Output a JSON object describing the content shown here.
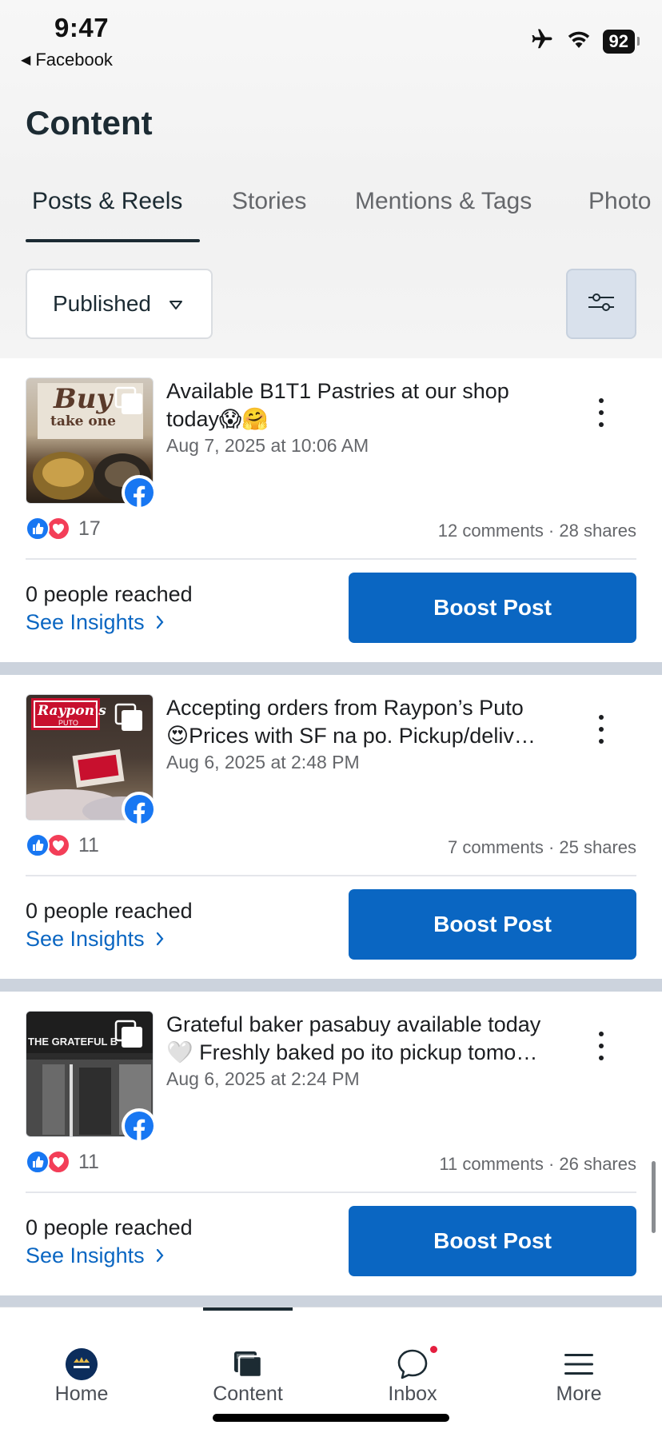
{
  "status_bar": {
    "time": "9:47",
    "back_app": "Facebook",
    "battery": "92"
  },
  "page": {
    "title": "Content"
  },
  "tabs": [
    {
      "label": "Posts & Reels",
      "active": true
    },
    {
      "label": "Stories",
      "active": false
    },
    {
      "label": "Mentions & Tags",
      "active": false
    },
    {
      "label": "Photo",
      "active": false
    }
  ],
  "filter": {
    "selected": "Published"
  },
  "posts": [
    {
      "text_line1": "Available B1T1 Pastries at our shop",
      "text_line2": "today😱🤗",
      "date": "Aug 7, 2025 at 10:06 AM",
      "reactions": "17",
      "engagement": "12 comments · 28 shares",
      "reach": "0 people reached",
      "insights_label": "See Insights",
      "boost_label": "Boost Post",
      "thumb_text_1": "Buy",
      "thumb_text_2": "take one"
    },
    {
      "text_line1": "Accepting orders from Raypon’s Puto",
      "text_line2": "😍Prices with SF na po. Pickup/deliv…",
      "date": "Aug 6, 2025 at 2:48 PM",
      "reactions": "11",
      "engagement": "7 comments · 25 shares",
      "reach": "0 people reached",
      "insights_label": "See Insights",
      "boost_label": "Boost Post",
      "thumb_text_1": "Raypon's",
      "thumb_text_2": "PUTO"
    },
    {
      "text_line1": "Grateful baker pasabuy available today",
      "text_line2": "🤍 Freshly baked po ito pickup tomo…",
      "date": "Aug 6, 2025 at 2:24 PM",
      "reactions": "11",
      "engagement": "11 comments · 26 shares",
      "reach": "0 people reached",
      "insights_label": "See Insights",
      "boost_label": "Boost Post",
      "thumb_text_1": "THE GRATEFUL B"
    }
  ],
  "bottom_nav": [
    {
      "label": "Home",
      "icon": "page-avatar-icon"
    },
    {
      "label": "Content",
      "icon": "content-icon",
      "active": true
    },
    {
      "label": "Inbox",
      "icon": "inbox-chat-icon",
      "has_notification": true
    },
    {
      "label": "More",
      "icon": "menu-icon"
    }
  ],
  "colors": {
    "accent": "#0a66c2",
    "facebook_blue": "#1877f2",
    "love_red": "#f33e58",
    "separator": "#ccd3dd"
  }
}
